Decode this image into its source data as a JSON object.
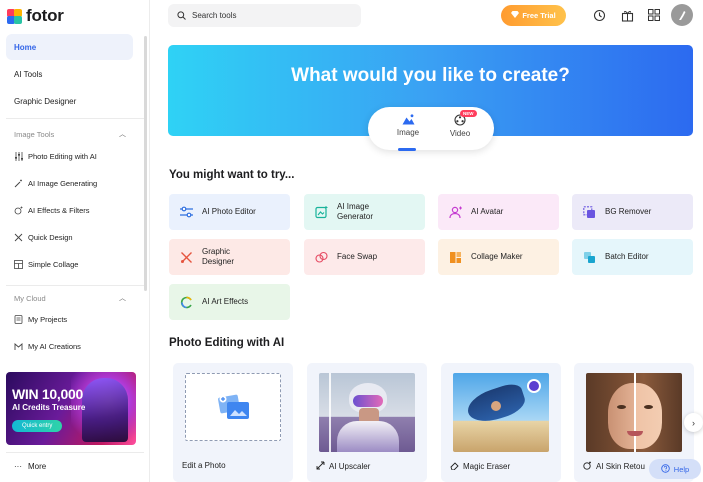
{
  "app": {
    "logo_text": "fotor"
  },
  "sidebar": {
    "nav": [
      {
        "label": "Home",
        "active": true
      },
      {
        "label": "AI Tools",
        "active": false
      },
      {
        "label": "Graphic Designer",
        "active": false
      }
    ],
    "image_tools": {
      "title": "Image Tools",
      "items": [
        {
          "label": "Photo Editing with AI",
          "icon": "sliders-icon"
        },
        {
          "label": "AI Image Generating",
          "icon": "magic-wand-icon"
        },
        {
          "label": "AI Effects & Filters",
          "icon": "sparkles-icon"
        },
        {
          "label": "Quick Design",
          "icon": "brush-icon"
        },
        {
          "label": "Simple Collage",
          "icon": "collage-icon"
        }
      ]
    },
    "my_cloud": {
      "title": "My Cloud",
      "items": [
        {
          "label": "My Projects",
          "icon": "document-icon"
        },
        {
          "label": "My AI Creations",
          "icon": "ai-creation-icon"
        }
      ]
    },
    "promo": {
      "line1": "WIN 10,000",
      "line2": "AI Credits Treasure",
      "button": "Quick entry"
    },
    "more_label": "More"
  },
  "topbar": {
    "search_label": "Search tools",
    "free_trial_label": "Free Trial",
    "icons": [
      "history-icon",
      "gift-icon",
      "apps-grid-icon"
    ]
  },
  "banner": {
    "title": "What would you like to create?",
    "tabs": [
      {
        "label": "Image",
        "active": true
      },
      {
        "label": "Video",
        "active": false,
        "badge": "NEW"
      }
    ]
  },
  "try_section": {
    "title": "You might want to try...",
    "tools": [
      {
        "label": "AI Photo Editor",
        "icon": "sliders-icon",
        "bg": "#eaf1fd",
        "accent": "#2f6fe0"
      },
      {
        "label": "AI Image Generator",
        "icon": "image-generator-icon",
        "bg": "#e3f7f3",
        "accent": "#18b39a"
      },
      {
        "label": "AI Avatar",
        "icon": "avatar-icon",
        "bg": "#fbe9f8",
        "accent": "#c53bd1"
      },
      {
        "label": "BG Remover",
        "icon": "bg-remover-icon",
        "bg": "#eceaf8",
        "accent": "#6a55e0"
      },
      {
        "label": "Graphic Designer",
        "icon": "design-tools-icon",
        "bg": "#fde9e6",
        "accent": "#e5553f"
      },
      {
        "label": "Face Swap",
        "icon": "face-swap-icon",
        "bg": "#fdeaea",
        "accent": "#e64b63"
      },
      {
        "label": "Collage Maker",
        "icon": "collage-icon",
        "bg": "#fdf1e3",
        "accent": "#f0901f"
      },
      {
        "label": "Batch Editor",
        "icon": "batch-layers-icon",
        "bg": "#e5f6fb",
        "accent": "#1aa5cf"
      },
      {
        "label": "AI Art Effects",
        "icon": "art-effects-icon",
        "bg": "#e8f6e8",
        "accent": "#3aa64a"
      }
    ]
  },
  "photo_section": {
    "title": "Photo Editing with AI",
    "cards": [
      {
        "label": "Edit a Photo",
        "icon": ""
      },
      {
        "label": "AI Upscaler",
        "icon": "upscale-icon"
      },
      {
        "label": "Magic Eraser",
        "icon": "eraser-icon"
      },
      {
        "label": "AI Skin Retou",
        "icon": "skin-retouch-icon"
      }
    ]
  },
  "help_label": "Help"
}
